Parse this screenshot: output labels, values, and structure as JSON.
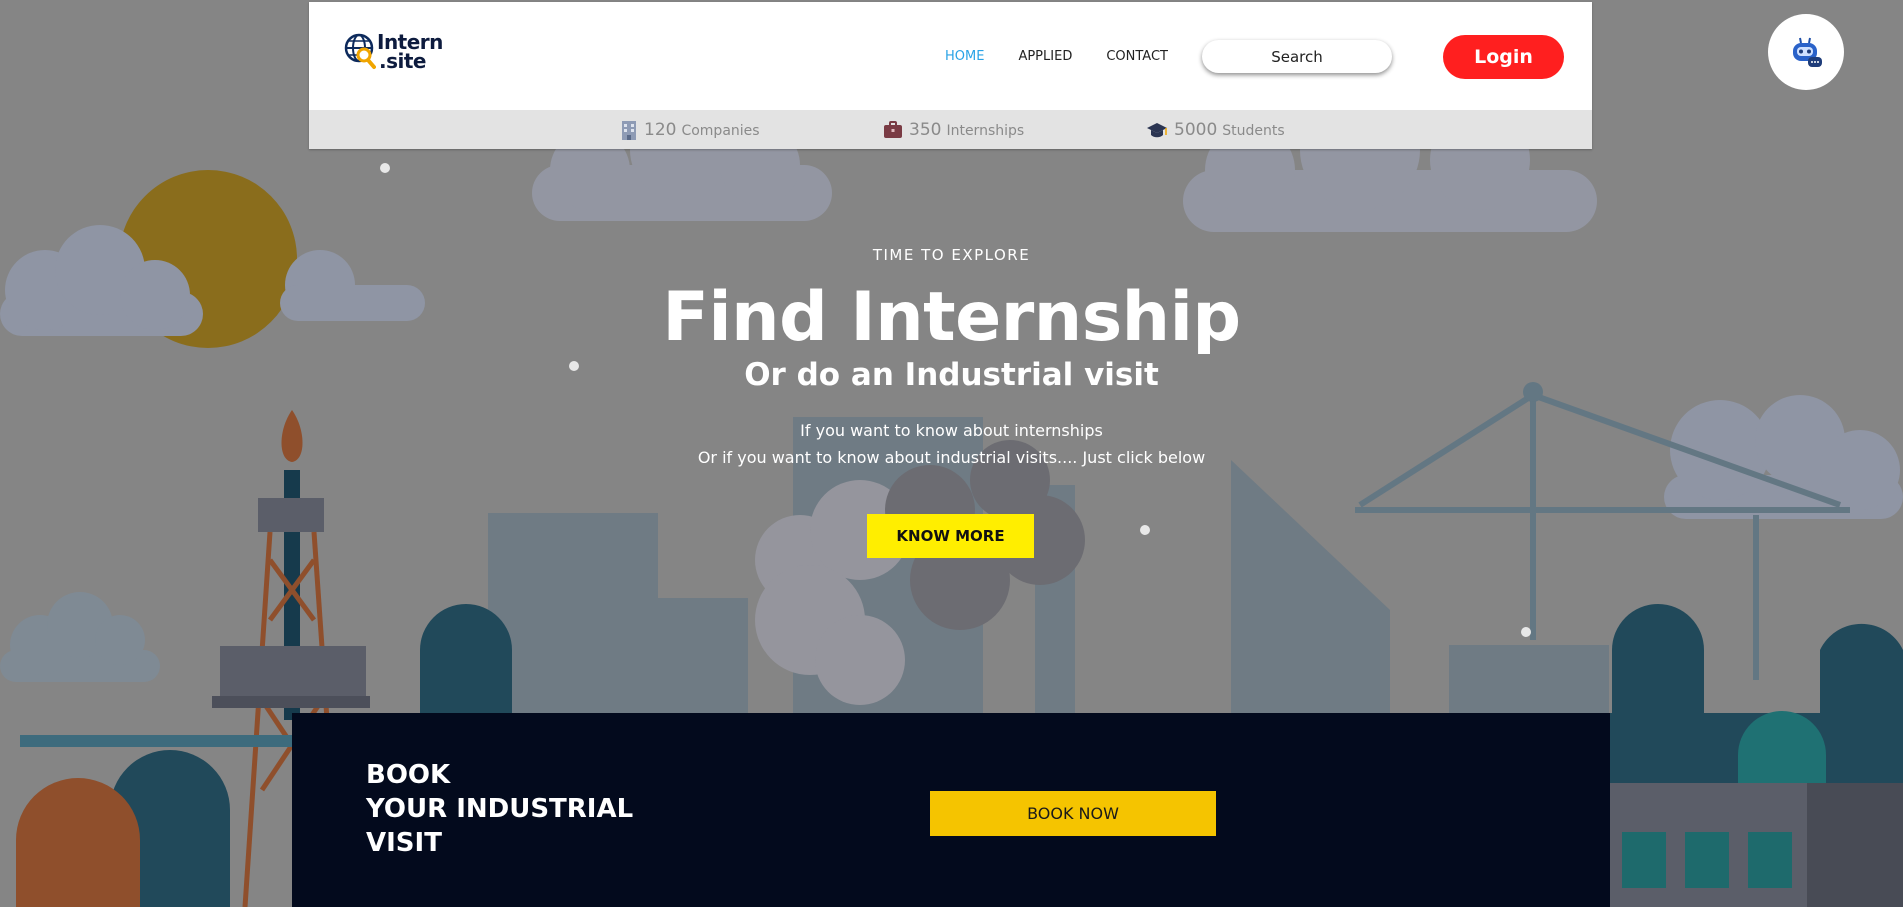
{
  "header": {
    "logo": {
      "line1": "Intern",
      "line2": ".site"
    },
    "nav": [
      {
        "label": "HOME",
        "active": true
      },
      {
        "label": "APPLIED",
        "active": false
      },
      {
        "label": "CONTACT",
        "active": false
      }
    ],
    "search": {
      "label": "Search"
    },
    "login_label": "Login"
  },
  "stats": [
    {
      "icon": "building-icon",
      "number": "120",
      "label": "Companies"
    },
    {
      "icon": "briefcase-icon",
      "number": "350",
      "label": "Internships"
    },
    {
      "icon": "graduation-cap-icon",
      "number": "5000",
      "label": "Students"
    }
  ],
  "chatbot": {
    "icon": "robot-chat-icon"
  },
  "hero": {
    "eyebrow": "TIME TO EXPLORE",
    "title": "Find Internship",
    "subtitle": "Or do an Industrial visit",
    "line1": "If you want to know about internships",
    "line2": "Or if you want to know about industrial visits.... Just click below",
    "cta_label": "KNOW MORE"
  },
  "booking": {
    "line1": "BOOK",
    "line2": "YOUR INDUSTRIAL",
    "line3": "VISIT",
    "cta_label": "BOOK NOW"
  },
  "colors": {
    "accent_nav": "#2aa3e6",
    "login_bg": "#ff1f1f",
    "know_more_bg": "#ffee00",
    "book_now_bg": "#f5c400",
    "booking_bg": "#030a1d",
    "overlay": "#858585"
  }
}
